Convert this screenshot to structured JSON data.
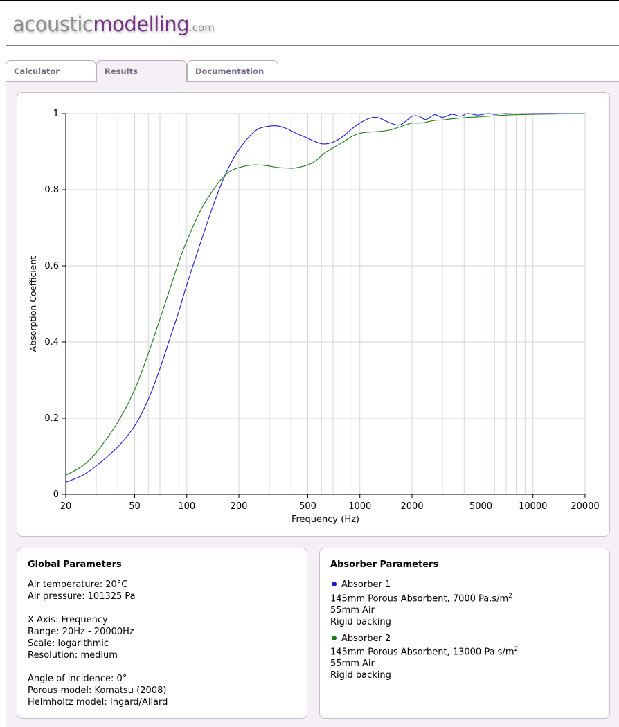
{
  "logo": {
    "part1": "acoustic",
    "part2": "modelling",
    "part3": ".com"
  },
  "tabs": [
    {
      "label": "Calculator",
      "active": false
    },
    {
      "label": "Results",
      "active": true
    },
    {
      "label": "Documentation",
      "active": false
    }
  ],
  "chart_data": {
    "type": "line",
    "xlabel": "Frequency (Hz)",
    "ylabel": "Absorption Coefficient",
    "xscale": "log",
    "xlim": [
      20,
      20000
    ],
    "ylim": [
      0,
      1
    ],
    "xticks": [
      20,
      50,
      100,
      200,
      500,
      1000,
      2000,
      5000,
      10000,
      20000
    ],
    "xtick_labels": [
      "20",
      "50",
      "100",
      "200",
      "500",
      "1000",
      "2000",
      "5000",
      "10000",
      "20000"
    ],
    "yticks": [
      0,
      0.2,
      0.4,
      0.6,
      0.8,
      1
    ],
    "ytick_labels": [
      "0",
      "0.2",
      "0.4",
      "0.6",
      "0.8",
      "1"
    ],
    "grid": true,
    "series": [
      {
        "name": "Absorber 1",
        "color": "#1a1ad0",
        "x": [
          20,
          25,
          30,
          40,
          50,
          60,
          70,
          80,
          90,
          100,
          120,
          140,
          160,
          180,
          200,
          230,
          260,
          300,
          340,
          380,
          420,
          500,
          560,
          620,
          700,
          800,
          900,
          1000,
          1100,
          1200,
          1300,
          1500,
          1700,
          1900,
          2000,
          2200,
          2400,
          2700,
          3000,
          3400,
          3800,
          4200,
          4800,
          5500,
          6000,
          7000,
          8000,
          10000,
          14000,
          20000
        ],
        "y": [
          0.032,
          0.05,
          0.075,
          0.125,
          0.18,
          0.25,
          0.33,
          0.41,
          0.48,
          0.55,
          0.66,
          0.75,
          0.82,
          0.87,
          0.905,
          0.94,
          0.96,
          0.967,
          0.967,
          0.96,
          0.95,
          0.935,
          0.925,
          0.92,
          0.925,
          0.94,
          0.96,
          0.975,
          0.985,
          0.99,
          0.988,
          0.975,
          0.97,
          0.985,
          0.993,
          0.993,
          0.984,
          0.997,
          0.99,
          0.998,
          0.993,
          1.0,
          0.996,
          1.0,
          0.998,
          1.0,
          0.999,
          1.0,
          1.0,
          1.0
        ]
      },
      {
        "name": "Absorber 2",
        "color": "#1a7a1a",
        "x": [
          20,
          25,
          30,
          40,
          50,
          60,
          70,
          80,
          90,
          100,
          120,
          140,
          160,
          180,
          200,
          230,
          260,
          300,
          340,
          380,
          420,
          500,
          560,
          620,
          700,
          800,
          900,
          1000,
          1100,
          1200,
          1300,
          1500,
          1700,
          1900,
          2000,
          2200,
          2400,
          2700,
          3000,
          3400,
          3800,
          4200,
          4800,
          5500,
          6000,
          7000,
          8000,
          10000,
          14000,
          20000
        ],
        "y": [
          0.05,
          0.075,
          0.11,
          0.19,
          0.275,
          0.37,
          0.46,
          0.54,
          0.61,
          0.665,
          0.745,
          0.795,
          0.83,
          0.85,
          0.858,
          0.864,
          0.865,
          0.862,
          0.858,
          0.857,
          0.857,
          0.865,
          0.877,
          0.895,
          0.91,
          0.925,
          0.94,
          0.948,
          0.951,
          0.952,
          0.953,
          0.957,
          0.965,
          0.972,
          0.975,
          0.975,
          0.977,
          0.982,
          0.983,
          0.986,
          0.988,
          0.99,
          0.991,
          0.993,
          0.994,
          0.996,
          0.997,
          0.998,
          0.999,
          1.0
        ]
      }
    ]
  },
  "global_params": {
    "title": "Global Parameters",
    "lines": [
      "Air temperature: 20°C",
      "Air pressure: 101325 Pa",
      "X Axis: Frequency",
      "Range: 20Hz - 20000Hz",
      "Scale: logarithmic",
      "Resolution: medium",
      "Angle of incidence: 0°",
      "Porous model: Komatsu (2008)",
      "Helmholtz model: Ingard/Allard"
    ]
  },
  "absorber_params": {
    "title": "Absorber Parameters",
    "absorbers": [
      {
        "name": "Absorber 1",
        "color": "#1a1ad0",
        "layer1": "145mm Porous Absorbent, 7000 Pa.s/m",
        "layer1_sup": "2",
        "layer2": "55mm Air",
        "layer3": "Rigid backing"
      },
      {
        "name": "Absorber 2",
        "color": "#1a7a1a",
        "layer1": "145mm Porous Absorbent, 13000 Pa.s/m",
        "layer1_sup": "2",
        "layer2": "55mm Air",
        "layer3": "Rigid backing"
      }
    ]
  }
}
